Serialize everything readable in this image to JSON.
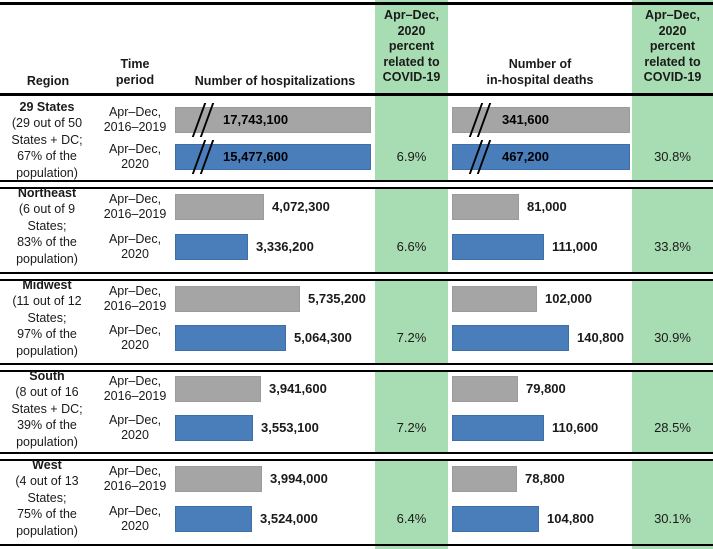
{
  "header": {
    "region": "Region",
    "time_period": "Time\nperiod",
    "time_period_l1": "Time",
    "time_period_l2": "period",
    "hospitalizations": "Number of hospitalizations",
    "pct_covid_hosp_l1": "Apr–Dec,",
    "pct_covid_hosp_l2": "2020",
    "pct_covid_hosp_l3": "percent",
    "pct_covid_hosp_l4": "related to",
    "pct_covid_hosp_l5": "COVID-19",
    "deaths_l1": "Number of",
    "deaths_l2": "in-hospital deaths",
    "pct_covid_death_l1": "Apr–Dec,",
    "pct_covid_death_l2": "2020",
    "pct_covid_death_l3": "percent",
    "pct_covid_death_l4": "related to",
    "pct_covid_death_l5": "COVID-19"
  },
  "colors": {
    "baseline_bar": "#a5a5a5",
    "covid_bar": "#4a7ebb",
    "percent_column_bg": "#a8dcb2",
    "rule": "#000000"
  },
  "period_labels": {
    "baseline_l1": "Apr–Dec,",
    "baseline_l2": "2016–2019",
    "covid_l1": "Apr–Dec,",
    "covid_l2": "2020"
  },
  "rows": [
    {
      "region_name": "29 States",
      "region_sub_l1": "(29 out of 50",
      "region_sub_l2": "States + DC;",
      "region_sub_l3": "67% of the",
      "region_sub_l4": "population)",
      "hosp_baseline_label": "17,743,100",
      "hosp_covid_label": "15,477,600",
      "hosp_pct": "6.9%",
      "death_baseline_label": "341,600",
      "death_covid_label": "467,200",
      "death_pct": "30.8%",
      "hosp_baseline_value": 17743100,
      "hosp_covid_value": 15477600,
      "death_baseline_value": 341600,
      "death_covid_value": 467200,
      "axis_break": true
    },
    {
      "region_name": "Northeast",
      "region_sub_l1": "(6 out of 9",
      "region_sub_l2": "States;",
      "region_sub_l3": "83% of the",
      "region_sub_l4": "population)",
      "hosp_baseline_label": "4,072,300",
      "hosp_covid_label": "3,336,200",
      "hosp_pct": "6.6%",
      "death_baseline_label": "81,000",
      "death_covid_label": "111,000",
      "death_pct": "33.8%",
      "hosp_baseline_value": 4072300,
      "hosp_covid_value": 3336200,
      "death_baseline_value": 81000,
      "death_covid_value": 111000,
      "axis_break": false
    },
    {
      "region_name": "Midwest",
      "region_sub_l1": "(11 out of 12",
      "region_sub_l2": "States;",
      "region_sub_l3": "97% of the",
      "region_sub_l4": "population)",
      "hosp_baseline_label": "5,735,200",
      "hosp_covid_label": "5,064,300",
      "hosp_pct": "7.2%",
      "death_baseline_label": "102,000",
      "death_covid_label": "140,800",
      "death_pct": "30.9%",
      "hosp_baseline_value": 5735200,
      "hosp_covid_value": 5064300,
      "death_baseline_value": 102000,
      "death_covid_value": 140800,
      "axis_break": false
    },
    {
      "region_name": "South",
      "region_sub_l1": "(8 out of 16",
      "region_sub_l2": "States + DC;",
      "region_sub_l3": "39% of the",
      "region_sub_l4": "population)",
      "hosp_baseline_label": "3,941,600",
      "hosp_covid_label": "3,553,100",
      "hosp_pct": "7.2%",
      "death_baseline_label": "79,800",
      "death_covid_label": "110,600",
      "death_pct": "28.5%",
      "hosp_baseline_value": 3941600,
      "hosp_covid_value": 3553100,
      "death_baseline_value": 79800,
      "death_covid_value": 110600,
      "axis_break": false
    },
    {
      "region_name": "West",
      "region_sub_l1": "(4 out of 13",
      "region_sub_l2": "States;",
      "region_sub_l3": "75% of the",
      "region_sub_l4": "population)",
      "hosp_baseline_label": "3,994,000",
      "hosp_covid_label": "3,524,000",
      "hosp_pct": "6.4%",
      "death_baseline_label": "78,800",
      "death_covid_label": "104,800",
      "death_pct": "30.1%",
      "hosp_baseline_value": 3994000,
      "hosp_covid_value": 3524000,
      "death_baseline_value": 78800,
      "death_covid_value": 104800,
      "axis_break": false
    }
  ],
  "chart_data": {
    "type": "bar",
    "title": "",
    "orientation": "horizontal",
    "grid": false,
    "legend": "none",
    "categories": [
      "29 States",
      "Northeast",
      "Midwest",
      "South",
      "West"
    ],
    "series": [
      {
        "name": "Hospitalizations Apr–Dec, 2016–2019",
        "values": [
          17743100,
          4072300,
          5735200,
          3941600,
          3994000
        ]
      },
      {
        "name": "Hospitalizations Apr–Dec, 2020",
        "values": [
          15477600,
          3336200,
          5064300,
          3553100,
          3524000
        ]
      },
      {
        "name": "In-hospital deaths Apr–Dec, 2016–2019",
        "values": [
          341600,
          81000,
          102000,
          79800,
          78800
        ]
      },
      {
        "name": "In-hospital deaths Apr–Dec, 2020",
        "values": [
          467200,
          111000,
          140800,
          110600,
          104800
        ]
      },
      {
        "name": "Apr–Dec, 2020 percent of hospitalizations related to COVID-19",
        "values": [
          "6.9%",
          "6.6%",
          "7.2%",
          "7.2%",
          "6.4%"
        ]
      },
      {
        "name": "Apr–Dec, 2020 percent of in-hospital deaths related to COVID-19",
        "values": [
          "30.8%",
          "33.8%",
          "30.9%",
          "28.5%",
          "30.1%"
        ]
      }
    ],
    "xlabel": "",
    "ylabel": "",
    "notes": "Top row bars are drawn with an axis break (//) because values are off-scale."
  }
}
